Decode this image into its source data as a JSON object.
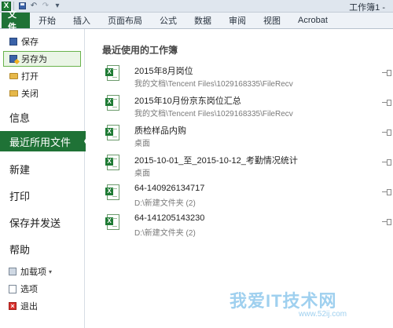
{
  "titlebar": {
    "app_icon": "excel-icon",
    "doc_title": "工作簿1 -"
  },
  "qat": {
    "save_icon": "save-icon",
    "undo": "↶",
    "redo": "↷",
    "customize": "▾"
  },
  "tabs": [
    "文件",
    "开始",
    "插入",
    "页面布局",
    "公式",
    "数据",
    "审阅",
    "视图",
    "Acrobat"
  ],
  "leftnav": {
    "small_items": [
      {
        "label": "保存",
        "icon": "save-icon"
      },
      {
        "label": "另存为",
        "icon": "save-as-icon"
      },
      {
        "label": "打开",
        "icon": "open-folder-icon"
      },
      {
        "label": "关闭",
        "icon": "close-folder-icon"
      }
    ],
    "info": "信息",
    "recent": "最近所用文件",
    "new": "新建",
    "print": "打印",
    "save_send": "保存并发送",
    "help": "帮助",
    "lower_items": [
      {
        "label": "加载项",
        "icon": "addin-icon",
        "suffix": "▾"
      },
      {
        "label": "选项",
        "icon": "options-icon"
      },
      {
        "label": "退出",
        "icon": "exit-icon"
      }
    ]
  },
  "main": {
    "section_title": "最近使用的工作簿",
    "files": [
      {
        "name": "2015年8月岗位",
        "path": "我的文档\\Tencent Files\\1029168335\\FileRecv"
      },
      {
        "name": "2015年10月份京东岗位汇总",
        "path": "我的文档\\Tencent Files\\1029168335\\FileRecv"
      },
      {
        "name": "质检样品内购",
        "path": "桌面"
      },
      {
        "name": "2015-10-01_至_2015-10-12_考勤情况统计",
        "path": "桌面"
      },
      {
        "name": "64-140926134717",
        "path": "D:\\新建文件夹 (2)"
      },
      {
        "name": "64-141205143230",
        "path": "D:\\新建文件夹 (2)"
      }
    ]
  },
  "watermark": {
    "text": "我爱IT技术网",
    "url": "www.52ij.com"
  }
}
